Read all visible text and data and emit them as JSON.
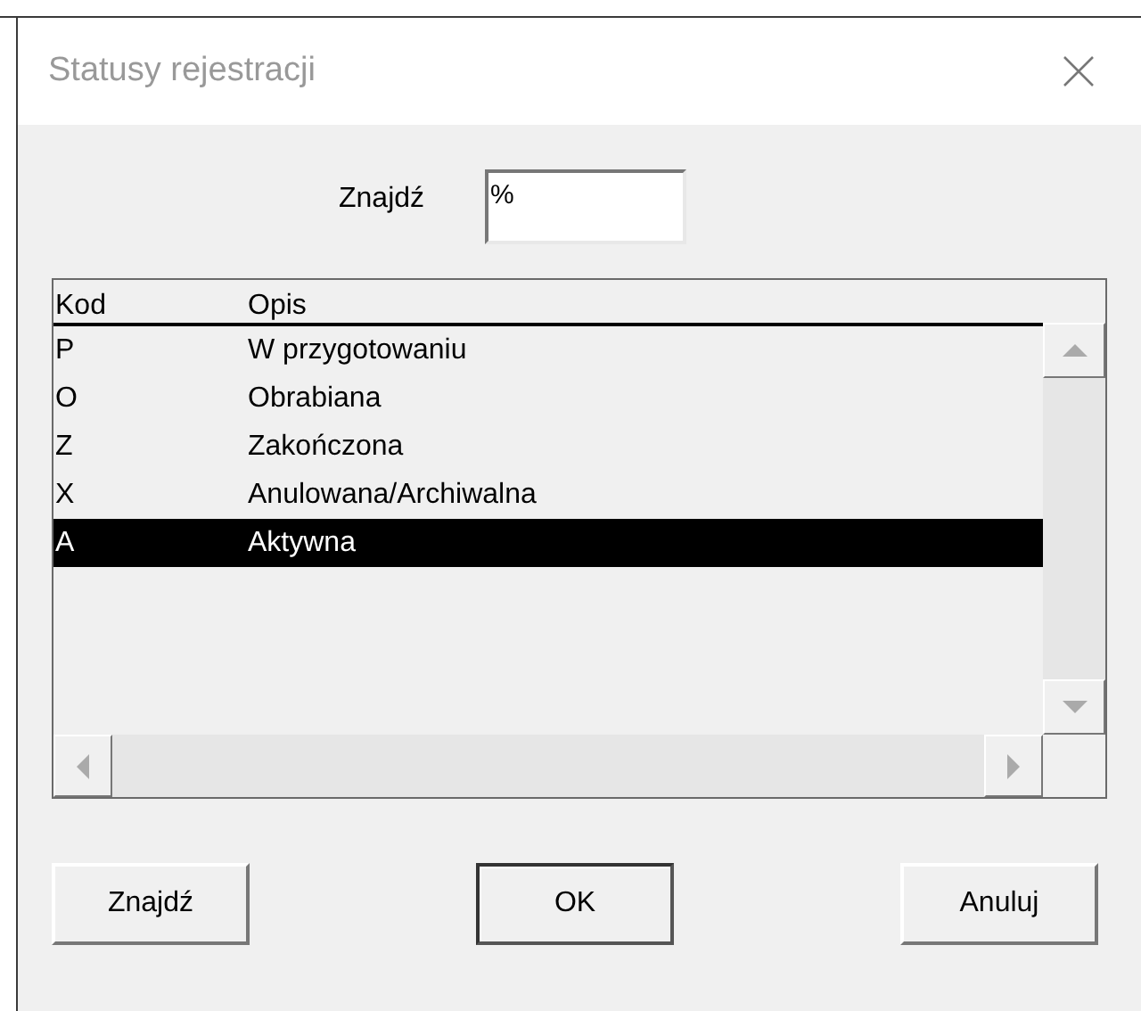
{
  "window": {
    "title": "Statusy rejestracji"
  },
  "search": {
    "label": "Znajdź",
    "value": "%"
  },
  "table": {
    "columns": [
      "Kod",
      "Opis"
    ],
    "rows": [
      {
        "cells": [
          "P",
          "W przygotowaniu"
        ],
        "selected": false
      },
      {
        "cells": [
          "O",
          "Obrabiana"
        ],
        "selected": false
      },
      {
        "cells": [
          "Z",
          "Zakończona"
        ],
        "selected": false
      },
      {
        "cells": [
          "X",
          "Anulowana/Archiwalna"
        ],
        "selected": false
      },
      {
        "cells": [
          "A",
          "Aktywna"
        ],
        "selected": true
      }
    ]
  },
  "buttons": [
    {
      "label": "Znajdź",
      "default": false
    },
    {
      "label": "OK",
      "default": true
    },
    {
      "label": "Anuluj",
      "default": false
    }
  ]
}
